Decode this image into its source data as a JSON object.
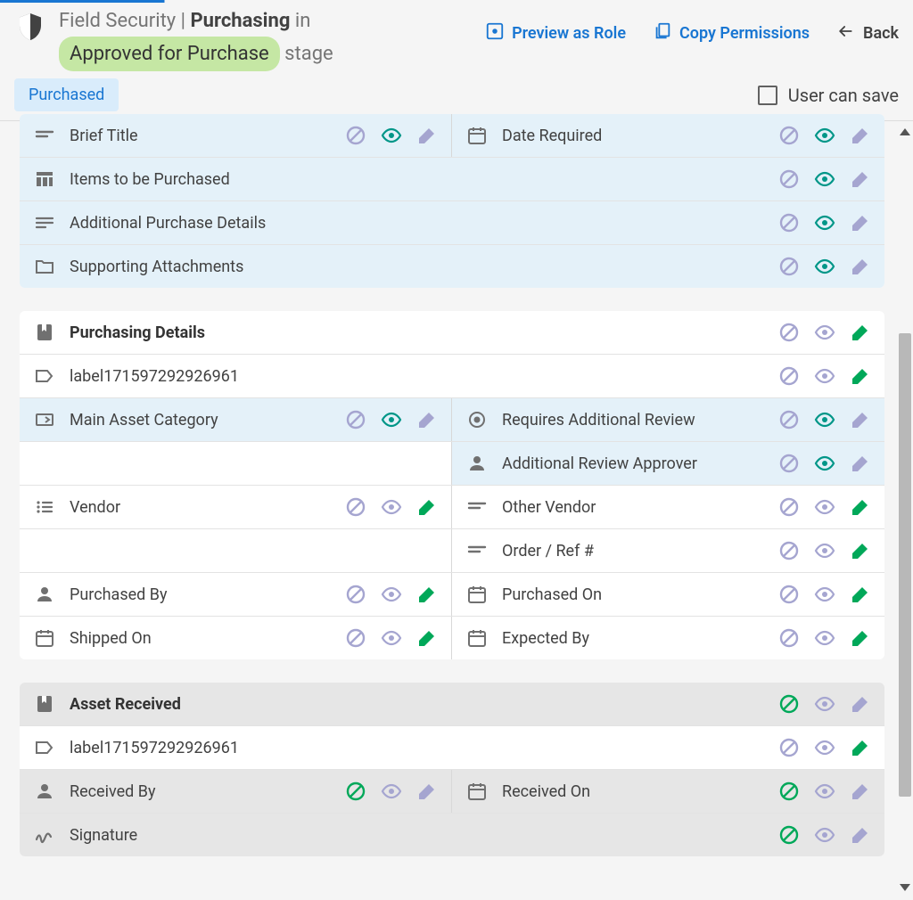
{
  "header": {
    "prefix": "Field Security | ",
    "app": "Purchasing",
    "in_text": " in",
    "stage_name": "Approved for Purchase",
    "stage_suffix": " stage",
    "preview_label": "Preview as Role",
    "copy_label": "Copy Permissions",
    "back_label": "Back",
    "chip_label": "Purchased",
    "save_label": "User can save"
  },
  "states": {
    "colors": {
      "block_muted": "#a5a5d0",
      "block_green": "#00a859",
      "eye_teal": "#009688",
      "eye_muted": "#a5a5d0",
      "pencil_muted": "#a5a5d0",
      "pencil_green": "#00a859"
    }
  },
  "rows": [
    {
      "card": 0,
      "cols": "two",
      "rowbg": "bg-blue",
      "left": {
        "icon": "short-text-icon",
        "label": "Brief Title",
        "block": "muted",
        "eye": "teal",
        "pencil": "muted"
      },
      "right": {
        "icon": "calendar-icon",
        "label": "Date Required",
        "block": "muted",
        "eye": "teal",
        "pencil": "muted"
      }
    },
    {
      "card": 0,
      "cols": "one",
      "rowbg": "bg-blue",
      "full": {
        "icon": "grid-icon",
        "label": "Items to be Purchased",
        "block": "muted",
        "eye": "teal",
        "pencil": "muted"
      }
    },
    {
      "card": 0,
      "cols": "one",
      "rowbg": "bg-blue",
      "full": {
        "icon": "long-text-icon",
        "label": "Additional Purchase Details",
        "block": "muted",
        "eye": "teal",
        "pencil": "muted"
      }
    },
    {
      "card": 0,
      "cols": "one",
      "rowbg": "bg-blue",
      "full": {
        "icon": "folder-icon",
        "label": "Supporting Attachments",
        "block": "muted",
        "eye": "teal",
        "pencil": "muted"
      }
    },
    {
      "card": 1,
      "cols": "one",
      "rowbg": "",
      "full": {
        "icon": "bookmark-icon",
        "label": "Purchasing Details",
        "bold": true,
        "block": "muted",
        "eye": "muted",
        "pencil": "green"
      }
    },
    {
      "card": 1,
      "cols": "one",
      "rowbg": "",
      "full": {
        "icon": "label-icon",
        "label": "label171597292926961",
        "block": "muted",
        "eye": "muted",
        "pencil": "green"
      }
    },
    {
      "card": 1,
      "cols": "two",
      "rowbg": "",
      "left": {
        "bg": "bg-blue",
        "icon": "input-icon",
        "label": "Main Asset Category",
        "block": "muted",
        "eye": "teal",
        "pencil": "muted"
      },
      "right": {
        "bg": "bg-blue",
        "icon": "radio-icon",
        "label": "Requires Additional Review",
        "block": "muted",
        "eye": "teal",
        "pencil": "muted"
      }
    },
    {
      "card": 1,
      "cols": "two",
      "rowbg": "",
      "left": {
        "icon": "",
        "label": "",
        "noactions": true
      },
      "right": {
        "bg": "bg-blue",
        "icon": "person-icon",
        "label": "Additional Review Approver",
        "block": "muted",
        "eye": "teal",
        "pencil": "muted"
      }
    },
    {
      "card": 1,
      "cols": "two",
      "rowbg": "",
      "left": {
        "icon": "list-icon",
        "label": "Vendor",
        "block": "muted",
        "eye": "muted",
        "pencil": "green"
      },
      "right": {
        "icon": "short-text-icon",
        "label": "Other Vendor",
        "block": "muted",
        "eye": "muted",
        "pencil": "green"
      }
    },
    {
      "card": 1,
      "cols": "two",
      "rowbg": "",
      "left": {
        "icon": "",
        "label": "",
        "noactions": true
      },
      "right": {
        "icon": "short-text-icon",
        "label": "Order / Ref #",
        "block": "muted",
        "eye": "muted",
        "pencil": "green"
      }
    },
    {
      "card": 1,
      "cols": "two",
      "rowbg": "",
      "left": {
        "icon": "person-icon",
        "label": "Purchased By",
        "block": "muted",
        "eye": "muted",
        "pencil": "green"
      },
      "right": {
        "icon": "calendar-icon",
        "label": "Purchased On",
        "block": "muted",
        "eye": "muted",
        "pencil": "green"
      }
    },
    {
      "card": 1,
      "cols": "two",
      "rowbg": "",
      "left": {
        "icon": "calendar-icon",
        "label": "Shipped On",
        "block": "muted",
        "eye": "muted",
        "pencil": "green"
      },
      "right": {
        "icon": "calendar-icon",
        "label": "Expected By",
        "block": "muted",
        "eye": "muted",
        "pencil": "green"
      }
    },
    {
      "card": 2,
      "cols": "one",
      "rowbg": "bg-grey",
      "full": {
        "icon": "bookmark-icon",
        "label": "Asset Received",
        "bold": true,
        "block": "green",
        "eye": "muted",
        "pencil": "muted"
      }
    },
    {
      "card": 2,
      "cols": "one",
      "rowbg": "",
      "full": {
        "icon": "label-icon",
        "label": "label171597292926961",
        "block": "muted",
        "eye": "muted",
        "pencil": "green"
      }
    },
    {
      "card": 2,
      "cols": "two",
      "rowbg": "bg-grey",
      "left": {
        "icon": "person-icon",
        "label": "Received By",
        "block": "green",
        "eye": "muted",
        "pencil": "muted"
      },
      "right": {
        "icon": "calendar-icon",
        "label": "Received On",
        "block": "green",
        "eye": "muted",
        "pencil": "muted"
      }
    },
    {
      "card": 2,
      "cols": "one",
      "rowbg": "bg-grey",
      "full": {
        "icon": "signature-icon",
        "label": "Signature",
        "block": "green",
        "eye": "muted",
        "pencil": "muted"
      }
    }
  ]
}
